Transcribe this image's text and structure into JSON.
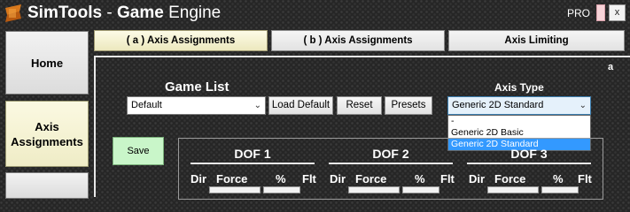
{
  "app": {
    "title_brand": "SimTools",
    "title_separator": " - ",
    "title_bold": "Game",
    "title_rest": " Engine",
    "pro_label": "PRO",
    "close_label": "x"
  },
  "sidebar": {
    "items": [
      {
        "label": "Home"
      },
      {
        "label": "Axis\nAssignments"
      },
      {
        "label": ""
      }
    ]
  },
  "tabs": [
    {
      "label": "( a ) Axis Assignments",
      "active": true
    },
    {
      "label": "( b ) Axis Assignments",
      "active": false
    },
    {
      "label": "Axis Limiting",
      "active": false
    }
  ],
  "panel": {
    "marker": "a",
    "game_list_label": "Game List",
    "game_list_value": "Default",
    "load_default_label": "Load Default",
    "reset_label": "Reset",
    "presets_label": "Presets",
    "axis_type_label": "Axis Type",
    "axis_type_value": "Generic 2D Standard",
    "axis_type_options": [
      "-",
      "Generic 2D Basic",
      "Generic 2D Standard"
    ],
    "axis_type_selected_index": 2,
    "save_label": "Save"
  },
  "dof": [
    {
      "title": "DOF 1",
      "dir": "Dir",
      "force": "Force",
      "pct": "%",
      "flt": "Flt"
    },
    {
      "title": "DOF 2",
      "dir": "Dir",
      "force": "Force",
      "pct": "%",
      "flt": "Flt"
    },
    {
      "title": "DOF 3",
      "dir": "Dir",
      "force": "Force",
      "pct": "%",
      "flt": "Flt"
    }
  ],
  "colors": {
    "active_tab": "#fdfbe6",
    "save_button": "#c9f6c9",
    "selection": "#3399ff"
  }
}
